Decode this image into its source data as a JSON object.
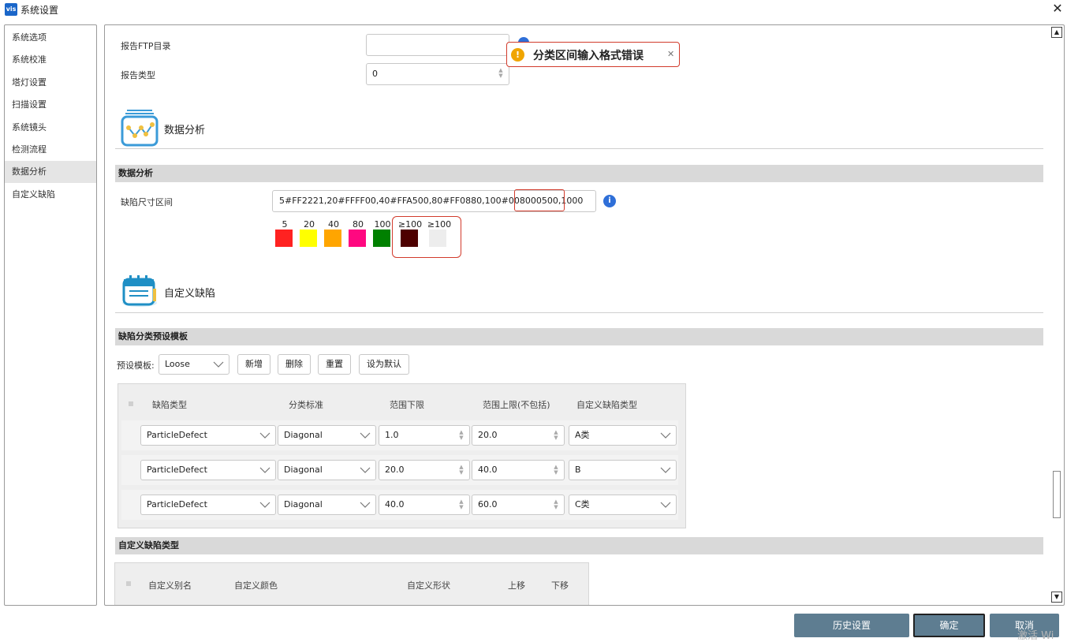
{
  "window": {
    "title": "系统设置",
    "logo_text": "vis",
    "close_glyph": "✕"
  },
  "sidebar": {
    "items": [
      {
        "label": "系统选项"
      },
      {
        "label": "系统校准"
      },
      {
        "label": "塔灯设置"
      },
      {
        "label": "扫描设置"
      },
      {
        "label": "系统镜头"
      },
      {
        "label": "检测流程"
      },
      {
        "label": "数据分析",
        "active": true
      },
      {
        "label": "自定义缺陷"
      }
    ]
  },
  "report": {
    "ftp_label": "报告FTP目录",
    "ftp_value": "",
    "type_label": "报告类型",
    "type_value": "0"
  },
  "toast": {
    "icon": "warning-icon",
    "message": "分类区间输入格式错误",
    "close_glyph": "✕"
  },
  "data_analysis": {
    "heading": "数据分析",
    "section_title": "数据分析",
    "defect_size_label": "缺陷尺寸区间",
    "defect_size_value": "5#FF2221,20#FFFF00,40#FFA500,80#FF0880,100#008000",
    "defect_size_value_highlight": "500,1000",
    "swatches": [
      {
        "label": "5",
        "color": "#ff2221"
      },
      {
        "label": "20",
        "color": "#ffff00"
      },
      {
        "label": "40",
        "color": "#ffa500"
      },
      {
        "label": "80",
        "color": "#ff0880"
      },
      {
        "label": "100",
        "color": "#008000"
      },
      {
        "label": "≥100",
        "color": "#4d0000"
      },
      {
        "label": "≥100",
        "color": "#ededed"
      }
    ]
  },
  "custom_defect": {
    "heading": "自定义缺陷",
    "preset_section_title": "缺陷分类预设模板",
    "preset_label": "预设模板:",
    "preset_value": "Loose",
    "buttons": {
      "add": "新增",
      "delete": "删除",
      "reset": "重置",
      "set_default": "设为默认"
    },
    "columns": [
      "缺陷类型",
      "分类标准",
      "范围下限",
      "范围上限(不包括)",
      "自定义缺陷类型"
    ],
    "rows": [
      {
        "type": "ParticleDefect",
        "standard": "Diagonal",
        "min": "1.0",
        "max": "20.0",
        "custom": "A类"
      },
      {
        "type": "ParticleDefect",
        "standard": "Diagonal",
        "min": "20.0",
        "max": "40.0",
        "custom": "B"
      },
      {
        "type": "ParticleDefect",
        "standard": "Diagonal",
        "min": "40.0",
        "max": "60.0",
        "custom": "C类"
      }
    ],
    "custom_type_section_title": "自定义缺陷类型",
    "custom_type_columns": [
      "自定义别名",
      "自定义颜色",
      "自定义形状",
      "上移",
      "下移"
    ]
  },
  "footer": {
    "history": "历史设置",
    "confirm": "确定",
    "cancel": "取消"
  },
  "watermark": "激活 Wi"
}
